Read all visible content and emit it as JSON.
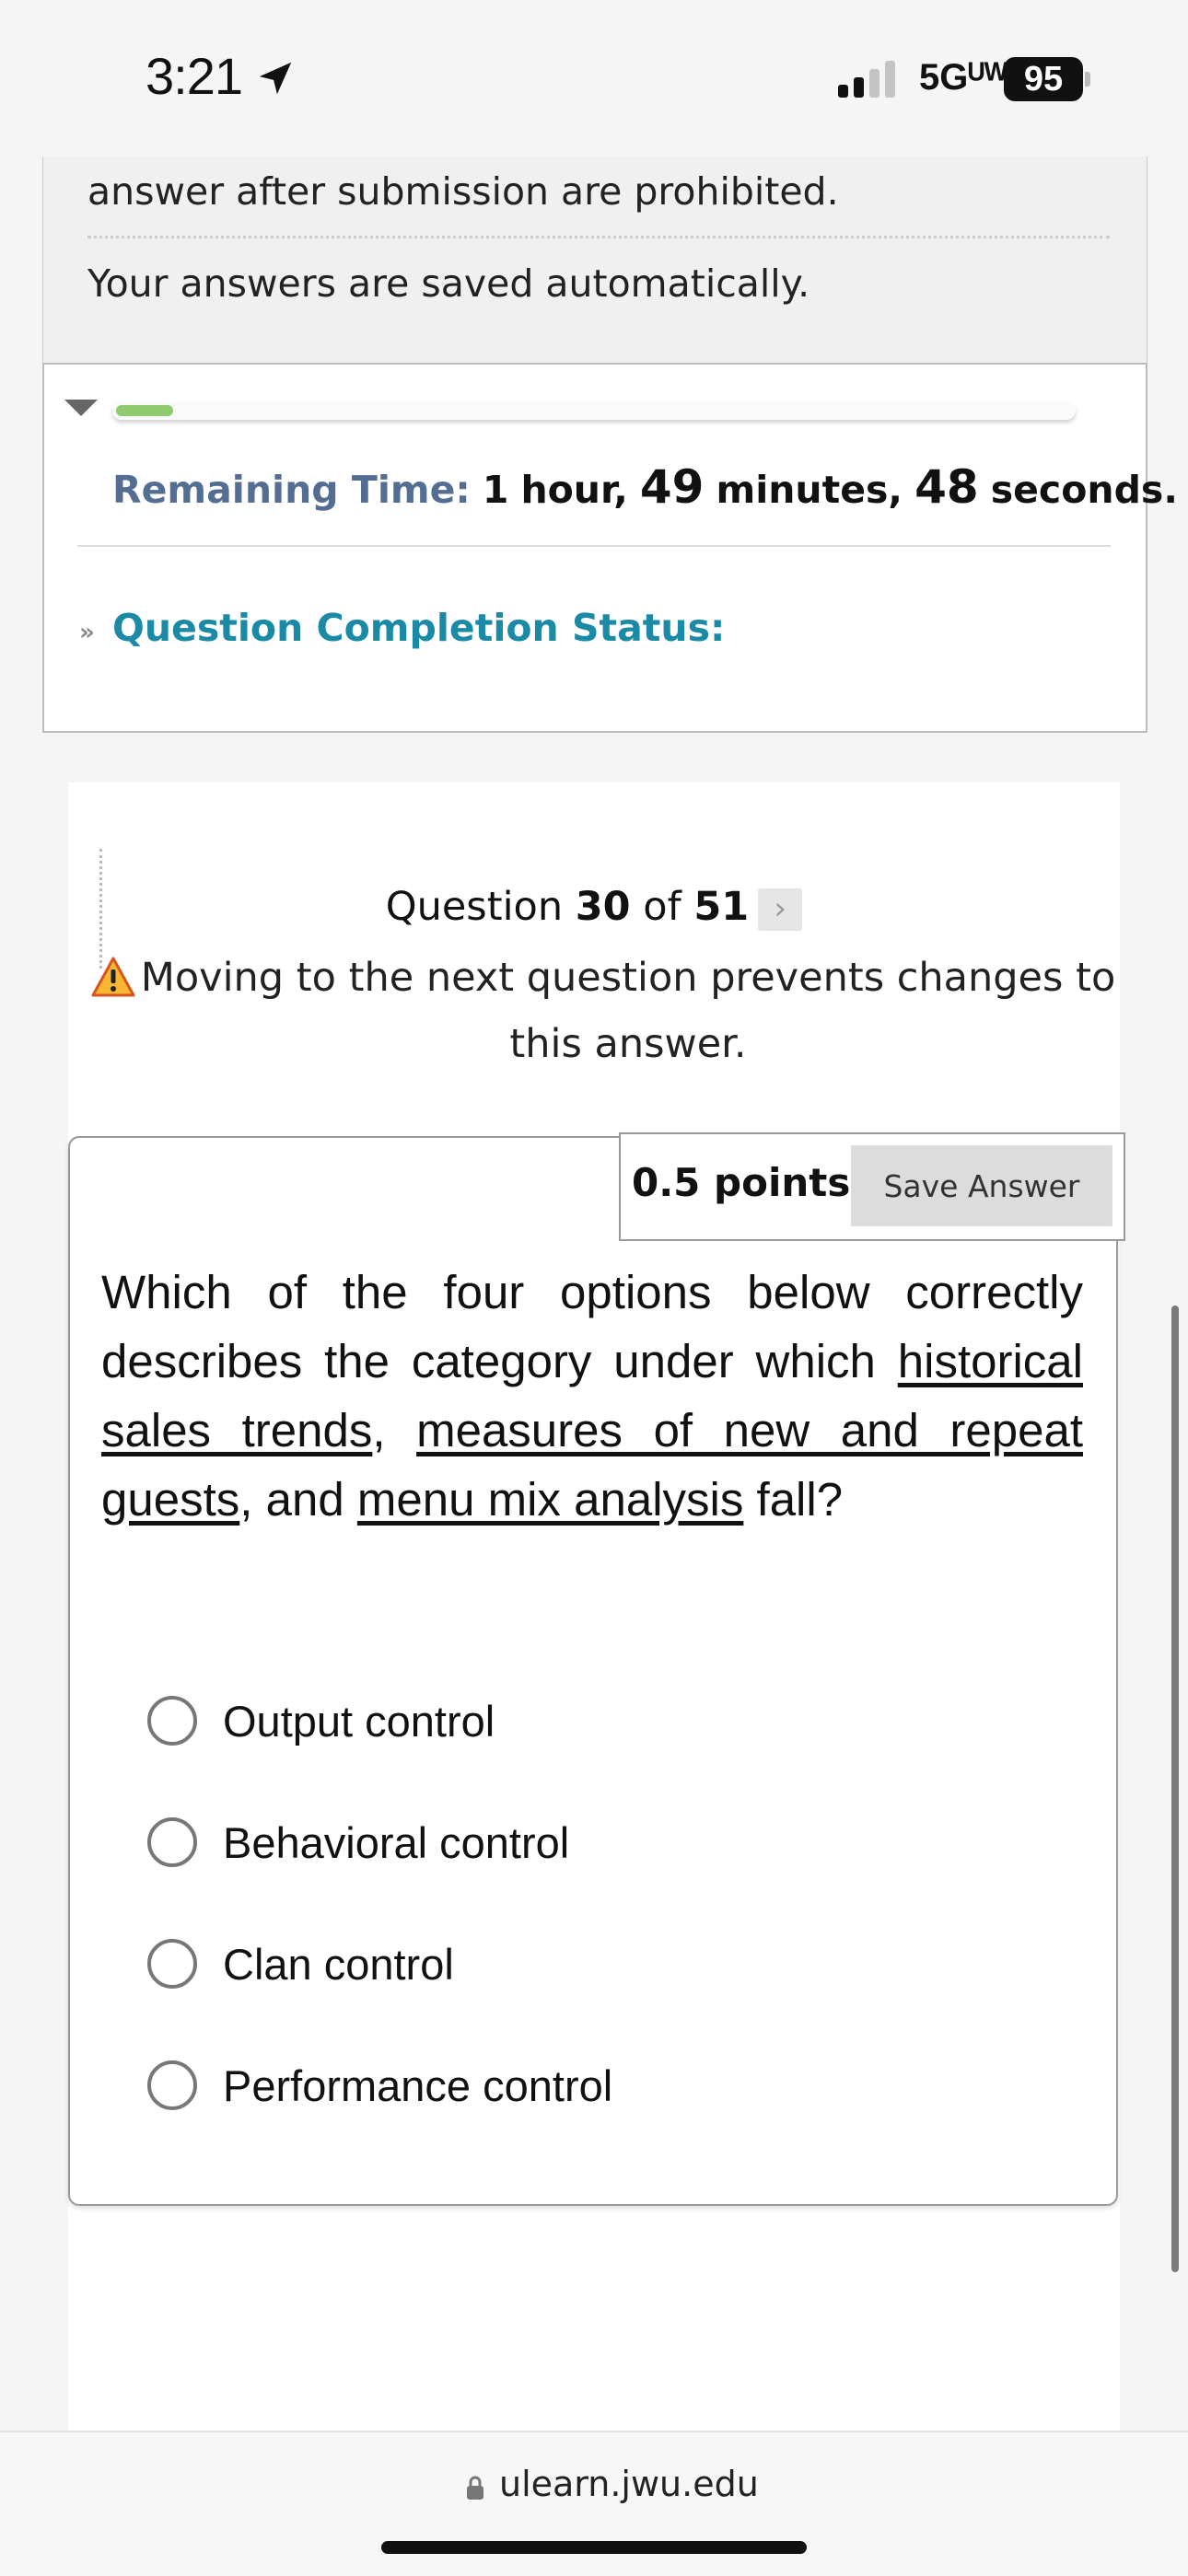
{
  "status_bar": {
    "time": "3:21",
    "network": "5Gᵁᵂ",
    "battery": "95"
  },
  "instructions": {
    "line1": "answer after submission are prohibited.",
    "line2": "Your answers are saved automatically."
  },
  "timer": {
    "progress_fraction": 0.06,
    "remaining_label": "Remaining Time:",
    "hours_value": "1",
    "hours_unit": "hour,",
    "minutes_value": "49",
    "minutes_unit": "minutes,",
    "seconds_value": "48",
    "seconds_unit": "seconds.",
    "completion_label": "Question Completion Status:"
  },
  "question_nav": {
    "prefix": "Question",
    "current": "30",
    "of": "of",
    "total": "51",
    "next_icon": "chevron-right-icon",
    "warning": "Moving to the next question prevents changes to this answer."
  },
  "question": {
    "points": "0.5 points",
    "save_label": "Save Answer",
    "text_part1": "Which of the four options below correctly describes the category under which ",
    "term1": "historical sales trends",
    "sep1": ", ",
    "term2": "measures of new and repeat guests",
    "sep2": ", and ",
    "term3": "menu mix analysis",
    "text_end": " fall?",
    "options": [
      {
        "label": "Output control",
        "selected": false
      },
      {
        "label": "Behavioral control",
        "selected": false
      },
      {
        "label": "Clan control",
        "selected": false
      },
      {
        "label": "Performance control",
        "selected": false
      }
    ]
  },
  "browser": {
    "url": "ulearn.jwu.edu"
  }
}
